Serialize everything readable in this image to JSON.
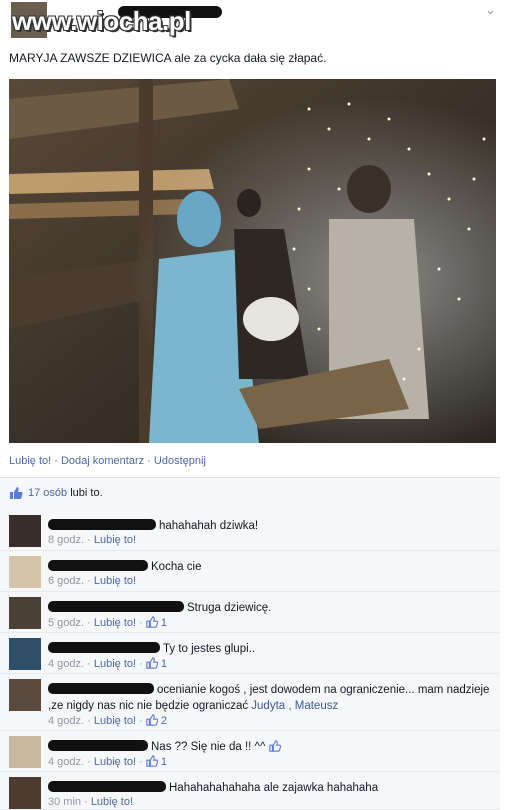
{
  "watermark": "www.wiocha.pl",
  "post": {
    "text": "MARYJA ZAWSZE DZIEWICA ale za cycka dała się złapać.",
    "actions": {
      "like": "Lubię to!",
      "comment": "Dodaj komentarz",
      "share": "Udostępnij",
      "sep": " · "
    }
  },
  "likes": {
    "count": "17 osób",
    "suffix": " lubi to."
  },
  "comments": [
    {
      "text": "hahahahah dziwka!",
      "time": "8 godz.",
      "like": "Lubię to!",
      "likes": ""
    },
    {
      "text": "Kocha cie",
      "time": "6 godz.",
      "like": "Lubię to!",
      "likes": ""
    },
    {
      "text": "Struga dziewicę.",
      "time": "5 godz.",
      "like": "Lubię to!",
      "likes": "1"
    },
    {
      "text": "Ty to jestes glupi..",
      "time": "4 godz.",
      "like": "Lubię to!",
      "likes": "1"
    },
    {
      "text": "ocenianie kogoś , jest dowodem na ograniczenie... mam nadzieje ,ze nigdy nas nic nie będzie ograniczać",
      "tags": "Judyta , Mateusz",
      "time": "4 godz.",
      "like": "Lubię to!",
      "likes": "2"
    },
    {
      "text": "Nas ?? Się nie da !! ^^",
      "time": "4 godz.",
      "like": "Lubię to!",
      "likes": "1"
    },
    {
      "text": "Hahahahahahaha ale zajawka hahahaha",
      "time": "30 min",
      "like": "Lubię to!",
      "likes": ""
    }
  ],
  "colors": {
    "link": "#4e69a2",
    "meta": "#9197a3",
    "bar": "#f6f7f8"
  }
}
